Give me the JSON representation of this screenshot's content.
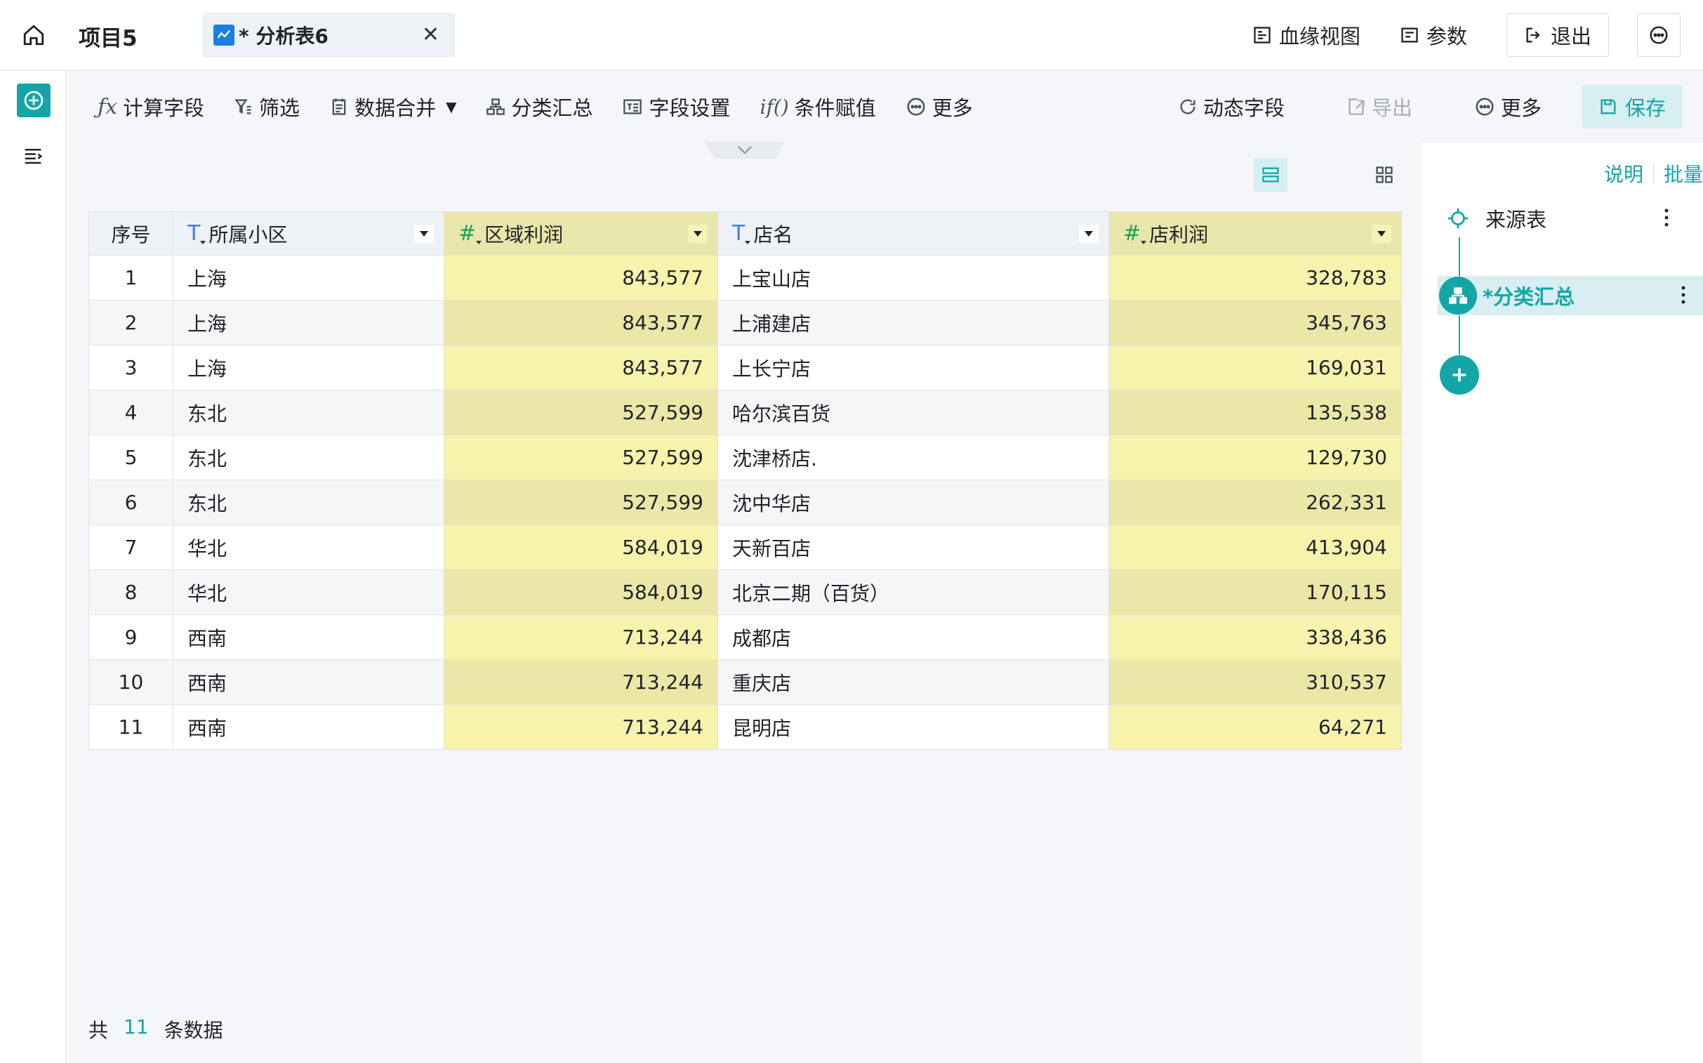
{
  "topbar": {
    "project_title": "项目5",
    "tab_label": "* 分析表6",
    "links": [
      {
        "label": "血缘视图",
        "icon": "lineage-icon"
      },
      {
        "label": "参数",
        "icon": "params-icon"
      }
    ],
    "exit_label": "退出"
  },
  "toolbar": {
    "left": [
      {
        "label": "计算字段",
        "icon": "fx-icon"
      },
      {
        "label": "筛选",
        "icon": "filter-icon"
      },
      {
        "label": "数据合并",
        "icon": "merge-icon"
      },
      {
        "label": "分类汇总",
        "icon": "group-icon"
      },
      {
        "label": "字段设置",
        "icon": "field-settings-icon"
      },
      {
        "label": "条件赋值",
        "icon": "if-icon"
      },
      {
        "label": "更多",
        "icon": "more-icon"
      }
    ],
    "right": [
      {
        "label": "动态字段",
        "icon": "refresh-icon"
      },
      {
        "label": "导出",
        "icon": "export-icon"
      },
      {
        "label": "更多",
        "icon": "more-icon"
      }
    ],
    "save_label": "保存"
  },
  "table": {
    "columns": [
      {
        "label": "序号",
        "type": "index"
      },
      {
        "label": "所属小区",
        "type": "text"
      },
      {
        "label": "区域利润",
        "type": "number"
      },
      {
        "label": "店名",
        "type": "text"
      },
      {
        "label": "店利润",
        "type": "number"
      }
    ],
    "rows": [
      [
        "1",
        "上海",
        "843,577",
        "上宝山店",
        "328,783"
      ],
      [
        "2",
        "上海",
        "843,577",
        "上浦建店",
        "345,763"
      ],
      [
        "3",
        "上海",
        "843,577",
        "上长宁店",
        "169,031"
      ],
      [
        "4",
        "东北",
        "527,599",
        "哈尔滨百货",
        "135,538"
      ],
      [
        "5",
        "东北",
        "527,599",
        "沈津桥店.",
        "129,730"
      ],
      [
        "6",
        "东北",
        "527,599",
        "沈中华店",
        "262,331"
      ],
      [
        "7",
        "华北",
        "584,019",
        "天新百店",
        "413,904"
      ],
      [
        "8",
        "华北",
        "584,019",
        "北京二期（百货）",
        "170,115"
      ],
      [
        "9",
        "西南",
        "713,244",
        "成都店",
        "338,436"
      ],
      [
        "10",
        "西南",
        "713,244",
        "重庆店",
        "310,537"
      ],
      [
        "11",
        "西南",
        "713,244",
        "昆明店",
        "64,271"
      ]
    ]
  },
  "footer": {
    "prefix": "共",
    "count": "11",
    "suffix": "条数据"
  },
  "rightpanel": {
    "links": [
      "说明",
      "批量"
    ],
    "nodes": [
      {
        "label": "来源表"
      },
      {
        "label": "*分类汇总"
      }
    ]
  },
  "colors": {
    "accent": "#14a6a6",
    "number_col": "#f7f2ac",
    "tab_icon": "#1b7fe0"
  }
}
